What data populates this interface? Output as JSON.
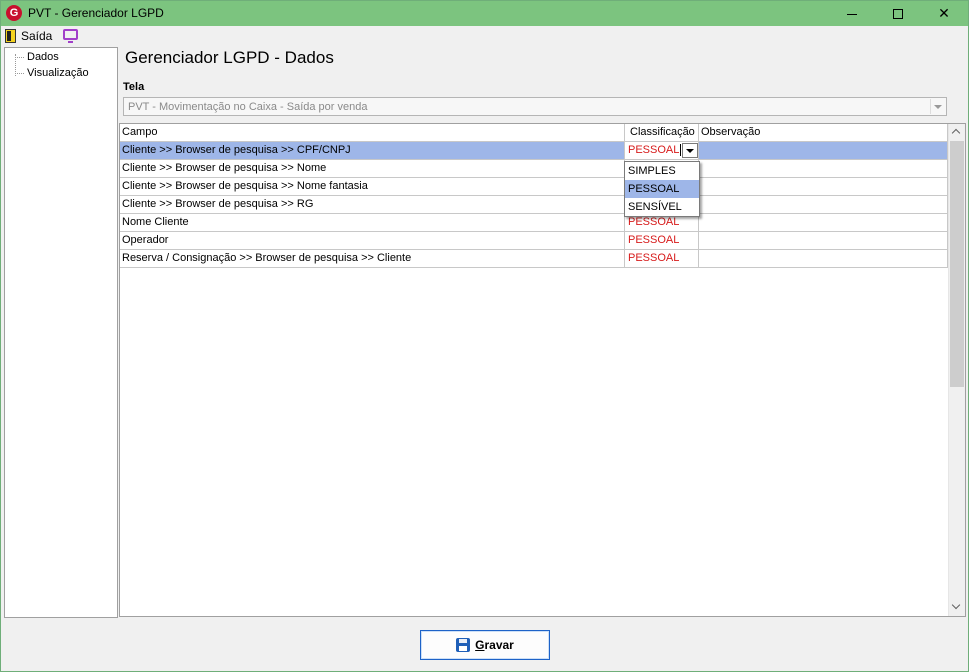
{
  "window": {
    "title": "PVT - Gerenciador LGPD",
    "app_icon_letter": "G",
    "controls": [
      "minimize-icon",
      "maximize-icon",
      "close-icon"
    ],
    "close_glyph": "✕"
  },
  "menu": {
    "exit_label": "Saída",
    "icons": [
      "door-exit-icon",
      "monitor-icon"
    ]
  },
  "sidebar": {
    "items": [
      {
        "label": "Dados"
      },
      {
        "label": "Visualização"
      }
    ]
  },
  "main": {
    "title": "Gerenciador LGPD - Dados",
    "tela_label": "Tela",
    "tela_value": "PVT - Movimentação no Caixa - Saída por venda"
  },
  "grid": {
    "columns": [
      "Campo",
      "Classificação",
      "Observação"
    ],
    "rows": [
      {
        "campo": "Cliente >> Browser de pesquisa >> CPF/CNPJ",
        "classificacao": "PESSOAL",
        "observacao": "",
        "selected": true
      },
      {
        "campo": "Cliente >> Browser de pesquisa >> Nome",
        "classificacao": "",
        "observacao": ""
      },
      {
        "campo": "Cliente >> Browser de pesquisa >> Nome fantasia",
        "classificacao": "",
        "observacao": ""
      },
      {
        "campo": "Cliente >> Browser de pesquisa >> RG",
        "classificacao": "",
        "observacao": ""
      },
      {
        "campo": "Nome Cliente",
        "classificacao": "PESSOAL",
        "observacao": ""
      },
      {
        "campo": "Operador",
        "classificacao": "PESSOAL",
        "observacao": ""
      },
      {
        "campo": "Reserva / Consignação >> Browser de pesquisa >> Cliente",
        "classificacao": "PESSOAL",
        "observacao": ""
      }
    ],
    "dropdown_options": [
      "SIMPLES",
      "PESSOAL",
      "SENSÍVEL"
    ],
    "dropdown_selected": "PESSOAL"
  },
  "footer": {
    "save_label_first": "G",
    "save_label_rest": "ravar"
  },
  "colors": {
    "titlebar": "#7cc47f",
    "selection": "#9eb6e8",
    "classification_text": "#d71b1b",
    "button_border": "#1e63c8"
  }
}
